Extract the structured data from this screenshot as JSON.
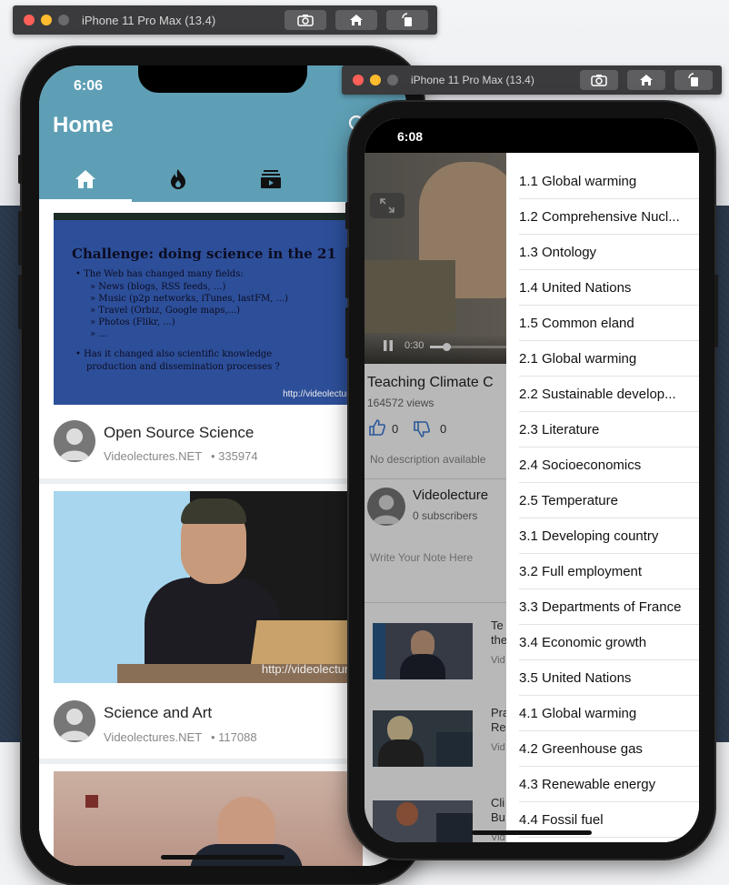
{
  "simulator": {
    "title1": "iPhone 11 Pro Max (13.4)",
    "title2": "iPhone 11 Pro Max (13.4)"
  },
  "home": {
    "time": "6:06",
    "title": "Home",
    "tabs": [
      {
        "icon": "home-icon",
        "active": true
      },
      {
        "icon": "flame-icon",
        "active": false
      },
      {
        "icon": "subscriptions-icon",
        "active": false
      }
    ],
    "slide": {
      "title": "Challenge: doing science in the 21",
      "lines": [
        "• The Web has changed many fields:",
        "» News (blogs, RSS feeds, ...)",
        "» Music (p2p networks, iTunes, lastFM, ...)",
        "» Travel (Orbiz, Google maps,...)",
        "» Photos (Flikr, ...)",
        "» ...",
        "• Has it changed also scientific knowledge",
        "production and dissemination processes ?"
      ],
      "url": "http://videolectures"
    },
    "cards": [
      {
        "title": "Open Source Science",
        "channel": "Videolectures.NET",
        "views": "• 335974"
      },
      {
        "title": "Science and Art",
        "channel": "Videolectures.NET",
        "views": "• 117088"
      }
    ],
    "card2_watermark": "http://videolectures"
  },
  "detail": {
    "time": "6:08",
    "player": {
      "elapsed": "0:30"
    },
    "title": "Teaching Climate C",
    "views": "164572 views",
    "likes": "0",
    "dislikes": "0",
    "description": "No description available",
    "channel": {
      "name": "Videolecture",
      "subscribers": "0 subscribers"
    },
    "note_placeholder": "Write Your Note Here",
    "related": [
      {
        "title_line1": "Te",
        "title_line2": "the",
        "meta": "Vid"
      },
      {
        "title_line1": "Pra",
        "title_line2": "Re",
        "meta": "Vid"
      },
      {
        "title_line1": "Cli",
        "title_line2": "Bu",
        "meta": "Vid"
      }
    ]
  },
  "menu": {
    "items": [
      "1.1 Global warming",
      "1.2 Comprehensive Nucl...",
      "1.3 Ontology",
      "1.4 United Nations",
      "1.5 Common eland",
      "2.1 Global warming",
      "2.2 Sustainable develop...",
      "2.3 Literature",
      "2.4 Socioeconomics",
      "2.5 Temperature",
      "3.1 Developing country",
      "3.2 Full employment",
      "3.3 Departments of France",
      "3.4 Economic growth",
      "3.5 United Nations",
      "4.1 Global warming",
      "4.2 Greenhouse gas",
      "4.3 Renewable energy",
      "4.4 Fossil fuel"
    ]
  },
  "colors": {
    "header": "#5e9fb5",
    "desktop_band": "#2b3a4e",
    "like": "#3a7bd5"
  }
}
